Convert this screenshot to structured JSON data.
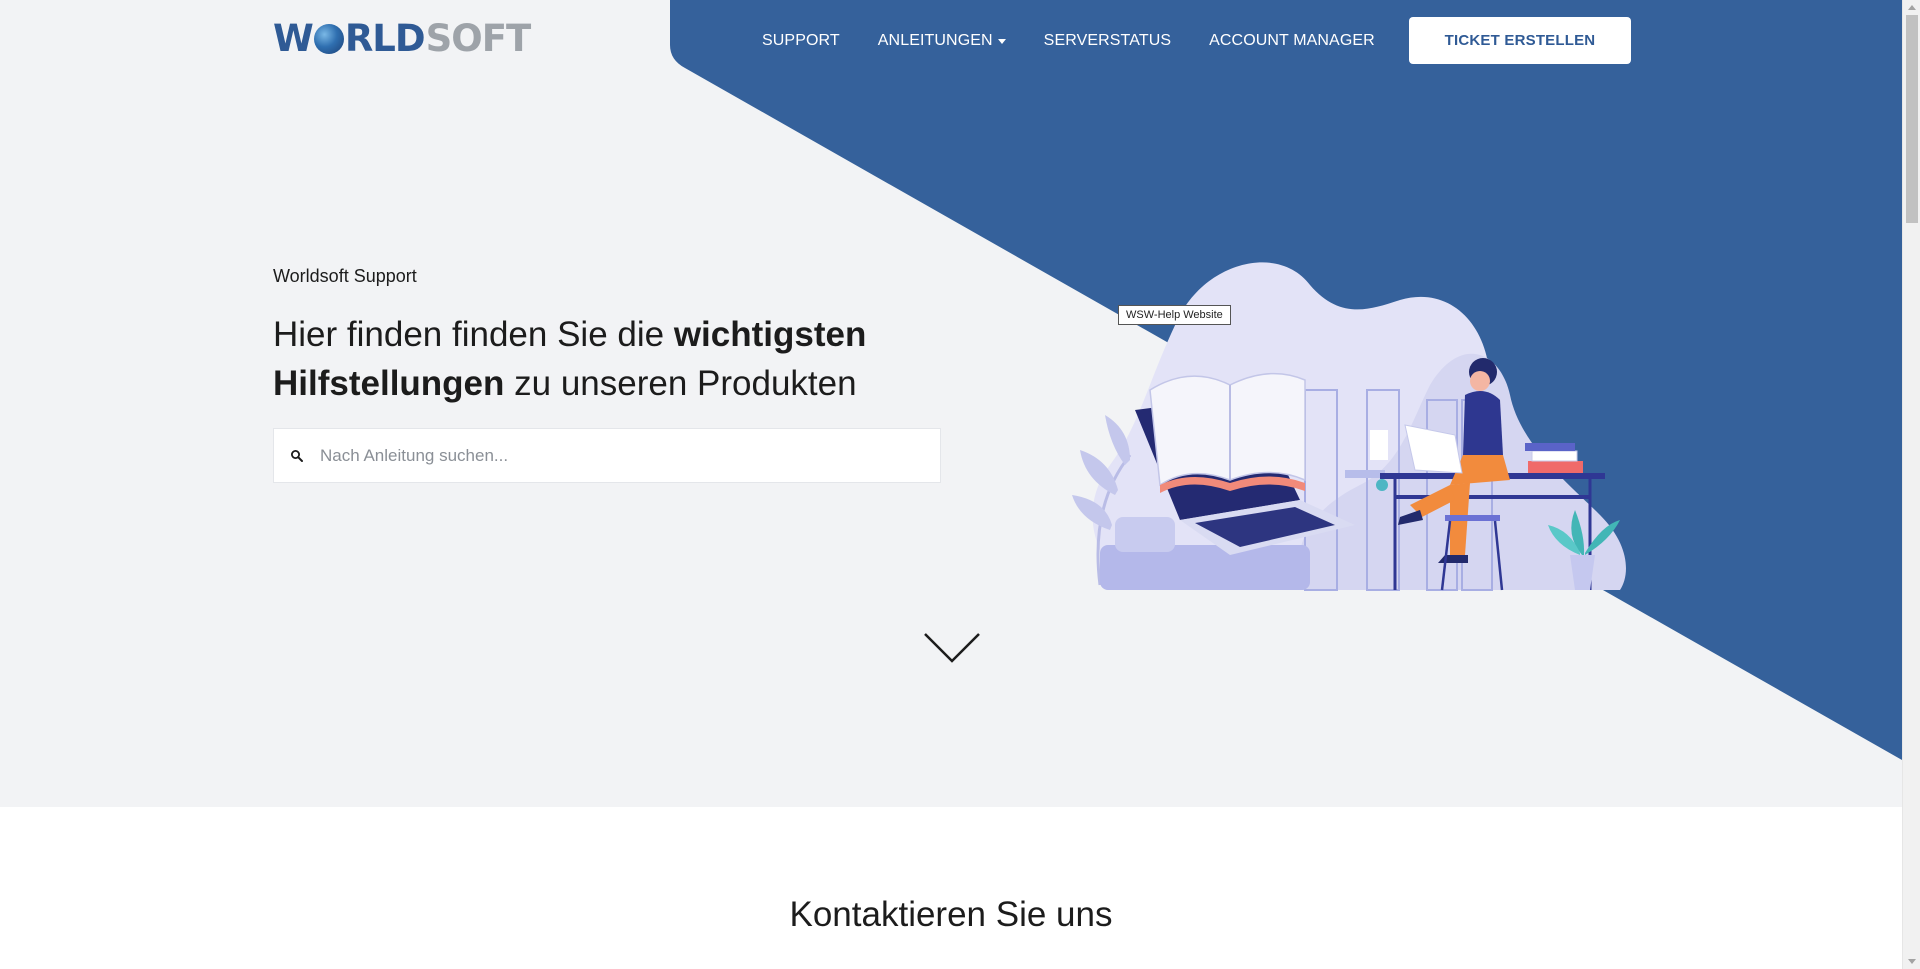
{
  "brand": {
    "logo_w": "W",
    "logo_rld": "RLD",
    "logo_soft": "SOFT",
    "primary_color": "#35619b",
    "background_color": "#f2f3f5"
  },
  "nav": {
    "items": [
      {
        "label": "SUPPORT"
      },
      {
        "label": "ANLEITUNGEN"
      },
      {
        "label": "SERVERSTATUS"
      },
      {
        "label": "ACCOUNT MANAGER"
      }
    ],
    "cta_label": "TICKET ERSTELLEN"
  },
  "hero": {
    "eyebrow": "Worldsoft Support",
    "headline_part1": "Hier finden finden Sie die ",
    "headline_bold1": "wichtigsten",
    "headline_bold2": "Hilfstellungen",
    "headline_part2": " zu unseren Produkten",
    "search_placeholder": "Nach Anleitung suchen...",
    "tooltip": "WSW-Help Website"
  },
  "icons": {
    "search": "search-icon",
    "dropdown": "caret-down-icon",
    "scroll": "chevron-down-icon"
  },
  "contact": {
    "title": "Kontaktieren Sie uns"
  }
}
